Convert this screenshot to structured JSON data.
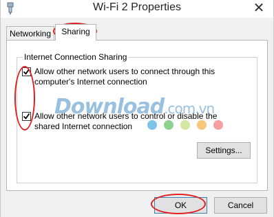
{
  "window": {
    "title": "Wi-Fi 2 Properties",
    "close_glyph": "✕"
  },
  "tabs": [
    {
      "label": "Networking",
      "selected": false
    },
    {
      "label": "Sharing",
      "selected": true
    }
  ],
  "sharing": {
    "group_label": "Internet Connection Sharing",
    "allow_connect": {
      "line1": "Allow other network users to connect through this",
      "line2": "computer's Internet connection",
      "checked": true
    },
    "allow_control": {
      "line1": "Allow other network users to control or disable the",
      "line2": "shared Internet connection",
      "checked": true
    },
    "settings_label": "Settings..."
  },
  "footer": {
    "ok_label": "OK",
    "cancel_label": "Cancel"
  },
  "watermark": {
    "main": "Download",
    "suffix": ".com.vn",
    "dot_colors": [
      "#7ec3e8",
      "#8fd18f",
      "#d4e6a0",
      "#f7c87a",
      "#f4a0a0",
      "#e86a6a"
    ]
  },
  "annotation_color": "#e02020"
}
